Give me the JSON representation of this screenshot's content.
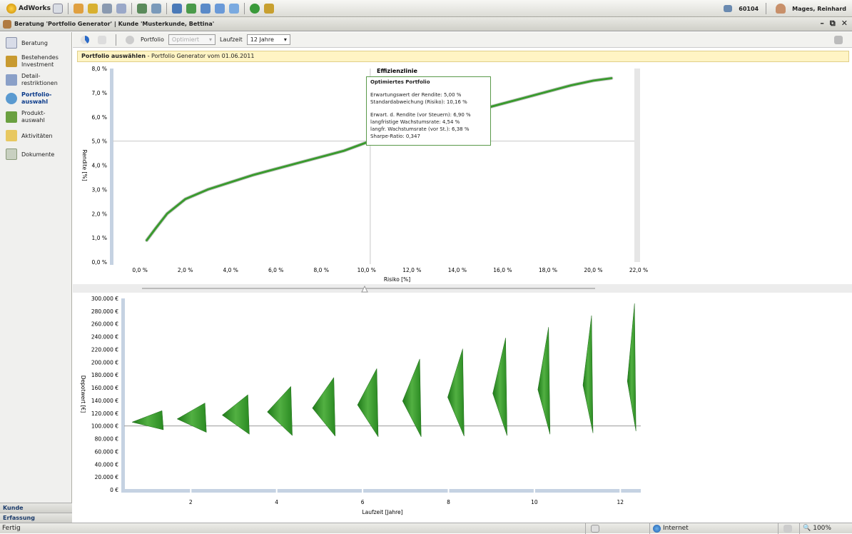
{
  "topbar": {
    "brand": "AdWorks",
    "code": "60104",
    "user": "Mages, Reinhard"
  },
  "titlebar": {
    "title": "Beratung 'Portfolio Generator' | Kunde 'Musterkunde, Bettina'"
  },
  "sidebar": {
    "items": [
      {
        "label": "Beratung",
        "active": false
      },
      {
        "label": "Bestehendes Investment",
        "active": false
      },
      {
        "label": "Detail-restriktionen",
        "active": false
      },
      {
        "label": "Portfolio-auswahl",
        "active": true
      },
      {
        "label": "Produkt-auswahl",
        "active": false
      },
      {
        "label": "Aktivitäten",
        "active": false
      },
      {
        "label": "Dokumente",
        "active": false
      }
    ],
    "bottom": [
      "Kunde",
      "Erfassung"
    ]
  },
  "toolbar": {
    "portfolio_label": "Portfolio",
    "portfolio_value": "Optimiert",
    "laufzeit_label": "Laufzeit",
    "laufzeit_value": "12 Jahre"
  },
  "infobar": {
    "bold": "Portfolio auswählen",
    "rest": " - Portfolio Generator vom 01.06.2011"
  },
  "tooltip": {
    "title": "Optimiertes Portfolio",
    "line1": "Erwartungswert der Rendite: 5,00 %",
    "line2": "Standardabweichung (Risiko): 10,16 %",
    "line3": "Erwart. d. Rendite (vor Steuern): 6,90 %",
    "line4": "langfristige Wachstumsrate: 4,54 %",
    "line5": "langfr. Wachstumsrate (vor St.): 6,38 %",
    "line6": "Sharpe-Ratio: 0,347"
  },
  "status": {
    "left": "Fertig",
    "zone": "Internet",
    "zoom": "100%"
  },
  "colors": {
    "series": "#3a9a2e",
    "accent": "#0a3a8a",
    "axis_band": "#c5d2e2"
  },
  "chart_data": [
    {
      "type": "line",
      "title": "Effizienzlinie",
      "xlabel": "Risiko [%]",
      "ylabel": "Rendite [%]",
      "xlim": [
        -1.2,
        22.0
      ],
      "ylim": [
        0.0,
        8.0
      ],
      "xticks": [
        "0,0 %",
        "2,0 %",
        "4,0 %",
        "6,0 %",
        "8,0 %",
        "10,0 %",
        "12,0 %",
        "14,0 %",
        "16,0 %",
        "18,0 %",
        "20,0 %",
        "22,0 %"
      ],
      "yticks": [
        "0,0 %",
        "1,0 %",
        "2,0 %",
        "3,0 %",
        "4,0 %",
        "5,0 %",
        "6,0 %",
        "7,0 %",
        "8,0 %"
      ],
      "x": [
        0.3,
        0.7,
        1.2,
        2.0,
        3.0,
        4.0,
        5.0,
        6.0,
        7.0,
        8.0,
        9.0,
        10.16,
        11.0,
        12.0,
        13.0,
        14.0,
        15.0,
        16.0,
        17.0,
        18.0,
        19.0,
        20.0,
        20.8
      ],
      "y": [
        0.9,
        1.4,
        2.0,
        2.6,
        3.0,
        3.3,
        3.6,
        3.85,
        4.1,
        4.35,
        4.6,
        5.0,
        5.3,
        5.55,
        5.8,
        6.05,
        6.3,
        6.55,
        6.8,
        7.05,
        7.3,
        7.5,
        7.6
      ],
      "marker": {
        "x": 10.16,
        "y": 5.0,
        "label": "Optimiertes Portfolio"
      },
      "grid": false
    },
    {
      "type": "area",
      "xlabel": "Laufzeit [Jahre]",
      "ylabel": "Depotwert [€]",
      "yticks": [
        "0 €",
        "20.000 €",
        "40.000 €",
        "60.000 €",
        "80.000 €",
        "100.000 €",
        "120.000 €",
        "140.000 €",
        "160.000 €",
        "180.000 €",
        "200.000 €",
        "220.000 €",
        "240.000 €",
        "260.000 €",
        "280.000 €",
        "300.000 €"
      ],
      "xticks": [
        "2",
        "4",
        "6",
        "8",
        "10",
        "12"
      ],
      "ylim": [
        0,
        300000
      ],
      "baseline": 100000,
      "years": [
        1,
        2,
        3,
        4,
        5,
        6,
        7,
        8,
        9,
        10,
        11,
        12
      ],
      "upper": [
        124000,
        136000,
        149000,
        162000,
        176000,
        190000,
        205000,
        221000,
        238000,
        255000,
        273000,
        292000
      ],
      "median": [
        106000,
        111000,
        117000,
        122000,
        128000,
        133000,
        139000,
        145000,
        151000,
        157000,
        164000,
        170000
      ],
      "lower": [
        94000,
        90000,
        87000,
        85000,
        84000,
        83000,
        83000,
        84000,
        85000,
        87000,
        89000,
        92000
      ]
    }
  ]
}
